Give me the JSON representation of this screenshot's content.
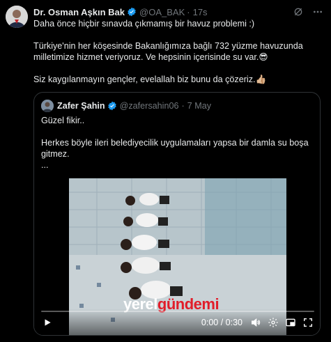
{
  "tweet": {
    "author_name": "Dr. Osman Aşkın Bak",
    "handle": "@OA_BAK",
    "separator": "·",
    "time": "17s",
    "paragraphs": [
      "Daha önce hiçbir sınavda çıkmamış bir havuz problemi :)",
      "Türkiye'nin her köşesinde Bakanlığımıza bağlı 732 yüzme havuzunda milletimize hizmet veriyoruz. Ve hepsinin içerisinde su var.😎",
      "Siz kaygılanmayın gençler, evelallah biz bunu da çözeriz.👍🏼"
    ]
  },
  "quote": {
    "author_name": "Zafer Şahin",
    "handle": "@zafersahin06",
    "separator": "·",
    "time": "7 May",
    "paragraphs": [
      "Güzel fikir..",
      "Herkes böyle ileri belediyecilik uygulamaları yapsa bir damla su boşa gitmez.",
      "..."
    ]
  },
  "video": {
    "time_display": "0:00 / 0:30",
    "progress": 0,
    "watermark_part1": "yerel",
    "watermark_part2": "gündemi"
  },
  "icons": {
    "verified": "verified-badge-icon",
    "grok": "grok-icon",
    "more": "more-icon",
    "play": "play-icon",
    "volume": "volume-icon",
    "settings": "settings-icon",
    "pip": "picture-in-picture-icon",
    "fullscreen": "fullscreen-icon"
  },
  "colors": {
    "background": "#000000",
    "text": "#e7e9ea",
    "secondary": "#71767b",
    "verified": "#1d9bf0",
    "border": "#2f3336"
  }
}
